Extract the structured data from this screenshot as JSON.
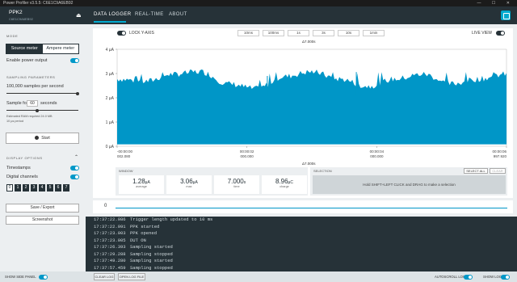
{
  "window_title": "Power Profiler v3.5.5: C6E1C9A6EB92",
  "window_controls": "— ☐ ✕",
  "device": {
    "name": "PPK2",
    "serial": "C6E1C9A6EB92"
  },
  "tabs": [
    {
      "label": "DATA LOGGER",
      "active": true
    },
    {
      "label": "REAL-TIME",
      "active": false
    },
    {
      "label": "ABOUT",
      "active": false
    }
  ],
  "sidebar": {
    "mode_heading": "MODE",
    "modes": [
      "Source meter",
      "Ampere meter"
    ],
    "selected_mode": "Source meter",
    "enable_power_label": "Enable power output",
    "sampling_heading": "SAMPLING PARAMETERS",
    "samples_label": "100,000 samples per second",
    "sample_for_label": "Sample for",
    "sample_for_value": "60",
    "sample_for_unit": "seconds",
    "ram_note": "Estimated RAM required 24.0 MB",
    "period_note": "10 µs period",
    "start_label": "Start",
    "display_heading": "DISPLAY OPTIONS",
    "timestamps_label": "Timestamps",
    "digital_label": "Digital channels",
    "channels": [
      "0",
      "1",
      "2",
      "3",
      "4",
      "5",
      "6",
      "7"
    ],
    "save_label": "Save / Export",
    "screenshot_label": "Screenshot",
    "show_side_panel": "SHOW SIDE PANEL"
  },
  "chart_toolbar": {
    "lock_y_label": "LOCK Y-AXIS",
    "time_windows": [
      "10ms",
      "100ms",
      "1s",
      "3s",
      "10s",
      "1min"
    ],
    "live_view_label": "LIVE VIEW",
    "top_marker": "Δ7.000s"
  },
  "chart_data": {
    "type": "area",
    "title": "",
    "ylabel": "",
    "ylim": [
      0,
      4
    ],
    "yticks": [
      "0 µA",
      "1 µA",
      "2 µA",
      "3 µA",
      "4 µA"
    ],
    "xticks": [
      {
        "t1": "-00:00:00",
        "t2": "002.080"
      },
      {
        "t1": "00:00:02",
        "t2": "000.000"
      },
      {
        "t1": "00:00:04",
        "t2": "000.000"
      },
      {
        "t1": "00:00:06",
        "t2": "997.920"
      }
    ],
    "x_seconds": [
      0,
      0.5,
      1,
      1.5,
      2,
      2.5,
      3,
      3.5,
      4,
      4.5,
      5,
      5.5,
      6,
      6.5,
      7
    ],
    "baseline_uA": [
      2.3,
      2.2,
      2.5,
      2.6,
      2.1,
      1.9,
      2.4,
      2.6,
      2.3,
      2.0,
      2.3,
      2.5,
      2.1,
      2.3,
      2.5
    ],
    "average_uA": 1.28,
    "max_uA": 3.06,
    "color": "#0096c7"
  },
  "window_stats": {
    "heading": "WINDOW",
    "average": {
      "value": "1.28",
      "unit": "µA",
      "label": "average"
    },
    "max": {
      "value": "3.06",
      "unit": "µA",
      "label": "max"
    },
    "time": {
      "value": "7.000",
      "unit": "s",
      "label": "time"
    },
    "charge": {
      "value": "8.96",
      "unit": "µC",
      "label": "charge"
    }
  },
  "selection": {
    "heading": "SELECTION",
    "select_all": "SELECT ALL",
    "clear": "CLEAR",
    "hint": "Hold SHIFT+LEFT CLICK and DRAG to make a selection"
  },
  "bottom_marker": "Δ7.000s",
  "digital_row_label": "0",
  "log": [
    {
      "time": "17:37:22.986",
      "msg": "Trigger length updated to 10 ms"
    },
    {
      "time": "17:37:22.991",
      "msg": "PPK started"
    },
    {
      "time": "17:37:23.003",
      "msg": "PPK opened"
    },
    {
      "time": "17:37:23.005",
      "msg": "DUT ON"
    },
    {
      "time": "17:37:26.393",
      "msg": "Sampling started"
    },
    {
      "time": "17:37:29.288",
      "msg": "Sampling stopped"
    },
    {
      "time": "17:37:49.280",
      "msg": "Sampling started"
    },
    {
      "time": "17:37:57.459",
      "msg": "Sampling stopped"
    }
  ],
  "footer": {
    "clear_log": "CLEAR LOG",
    "open_log_file": "OPEN LOG FILE",
    "autoscroll": "AUTOSCROLL LOG",
    "show_log": "SHOW LOG"
  }
}
